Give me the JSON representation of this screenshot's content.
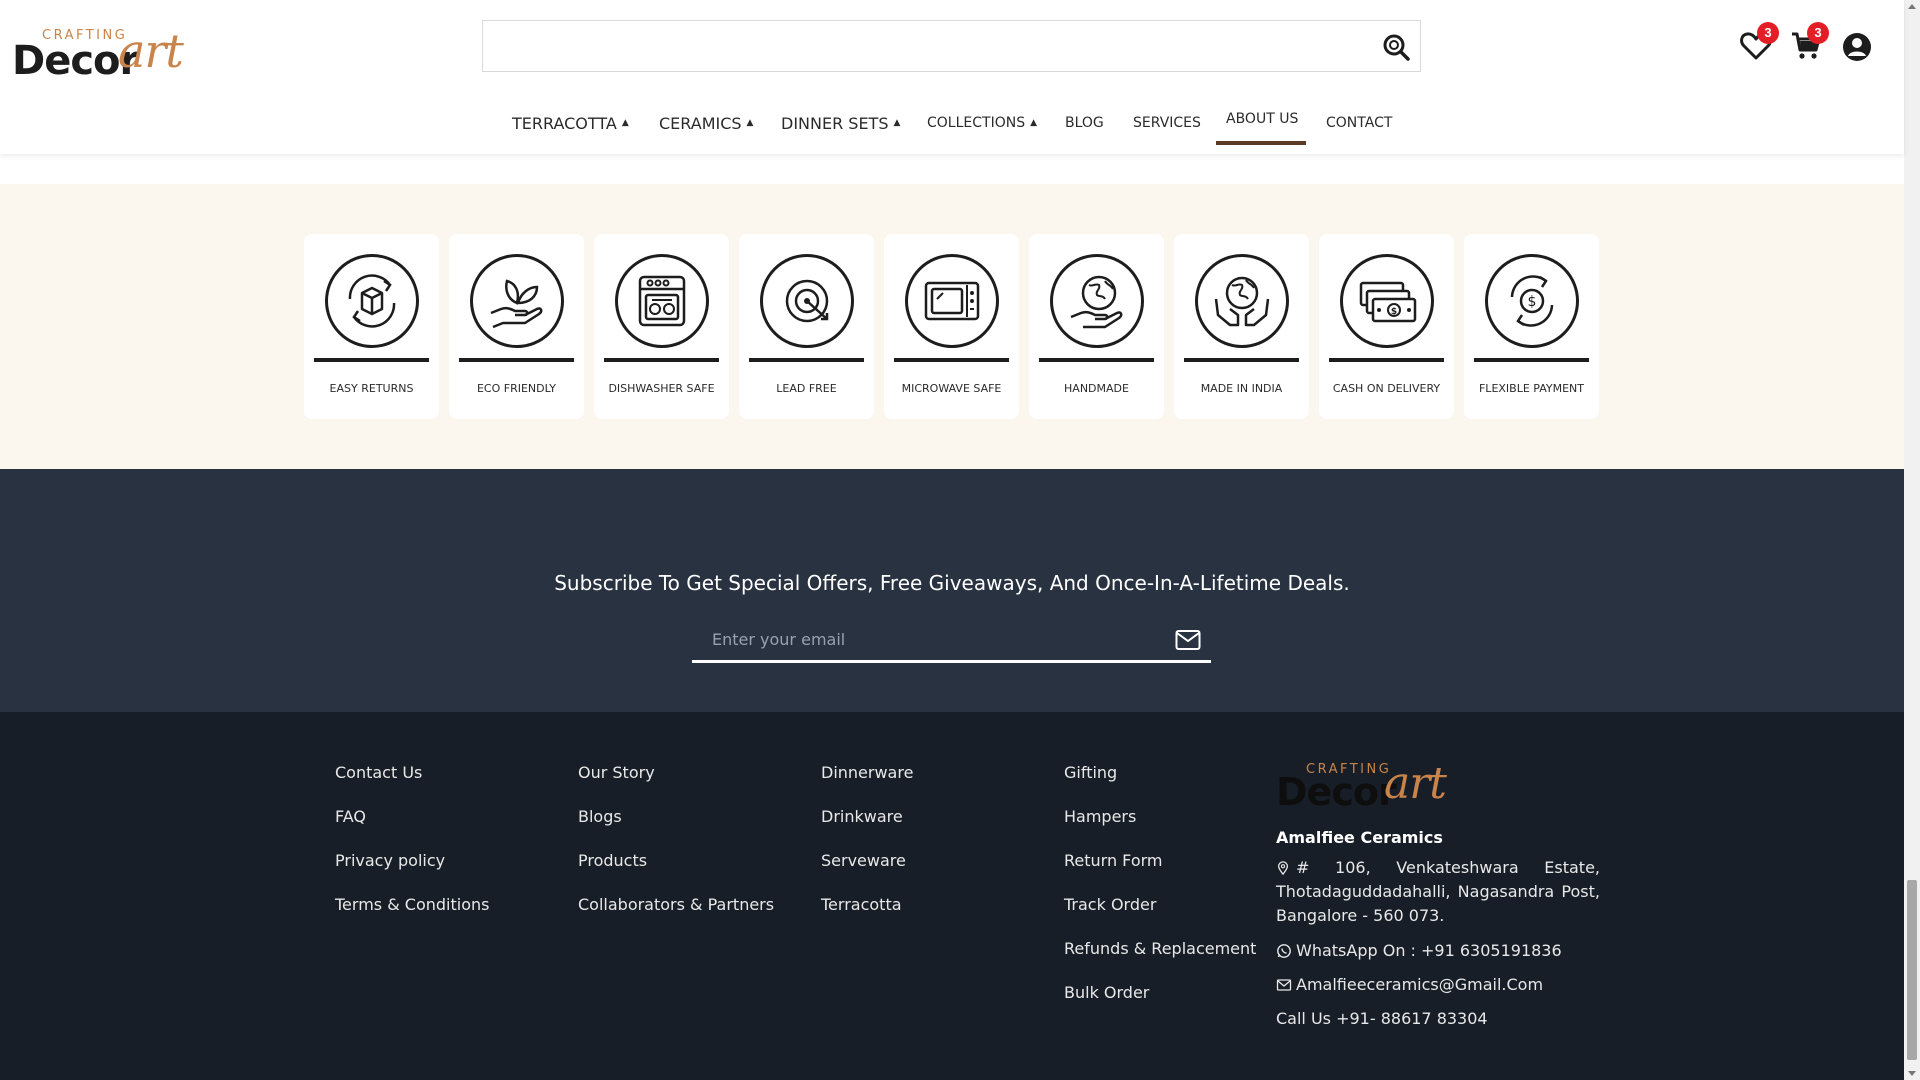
{
  "brand": {
    "logo_small": "CRAFTING",
    "logo_main": "Decor",
    "logo_script": "art",
    "accent_color": "#c8844a"
  },
  "search": {
    "value": "",
    "placeholder": ""
  },
  "header_icons": {
    "wishlist_count": "3",
    "cart_count": "3",
    "badge_color": "#e41e26"
  },
  "nav": {
    "items": [
      {
        "label": "TERRACOTTA",
        "dropdown": true
      },
      {
        "label": "CERAMICS",
        "dropdown": true
      },
      {
        "label": "DINNER SETS",
        "dropdown": true
      },
      {
        "label": "COLLECTIONS",
        "dropdown": true
      },
      {
        "label": "BLOG",
        "dropdown": false
      },
      {
        "label": "SERVICES",
        "dropdown": false
      },
      {
        "label": "ABOUT US",
        "dropdown": false,
        "active": true
      },
      {
        "label": "CONTACT",
        "dropdown": false
      }
    ],
    "caret": "▲",
    "active_color": "#5b3b26"
  },
  "features": [
    {
      "label": "EASY RETURNS",
      "icon": "return-box-icon"
    },
    {
      "label": "ECO FRIENDLY",
      "icon": "leaf-hand-icon"
    },
    {
      "label": "DISHWASHER SAFE",
      "icon": "dishwasher-icon"
    },
    {
      "label": "LEAD FREE",
      "icon": "target-icon"
    },
    {
      "label": "MICROWAVE SAFE",
      "icon": "microwave-icon"
    },
    {
      "label": "HANDMADE",
      "icon": "globe-hand-icon"
    },
    {
      "label": "MADE IN INDIA",
      "icon": "globe-hands-icon"
    },
    {
      "label": "CASH ON DELIVERY",
      "icon": "cash-icon"
    },
    {
      "label": "FLEXIBLE PAYMENT",
      "icon": "dollar-cycle-icon"
    }
  ],
  "subscribe": {
    "title": "Subscribe To Get Special Offers, Free Giveaways, And Once-In-A-Lifetime Deals.",
    "placeholder": "Enter your email",
    "value": ""
  },
  "footer": {
    "col1": [
      "Contact Us",
      "FAQ",
      "Privacy policy",
      "Terms & Conditions"
    ],
    "col2": [
      "Our Story",
      "Blogs",
      "Products",
      "Collaborators & Partners"
    ],
    "col3": [
      "Dinnerware",
      "Drinkware",
      "Serveware",
      "Terracotta"
    ],
    "col4": [
      "Gifting",
      "Hampers",
      "Return Form",
      "Track Order",
      "Refunds & Replacement",
      "Bulk Order"
    ],
    "company": "Amalfiee Ceramics",
    "address": "# 106, Venkateshwara Estate, Thotadaguddadahalli, Nagasandra Post, Bangalore - 560 073.",
    "whatsapp": "WhatsApp On : +91 6305191836",
    "email": "Amalfieeceramics@Gmail.Com",
    "phone": "Call Us +91- 88617 83304"
  }
}
